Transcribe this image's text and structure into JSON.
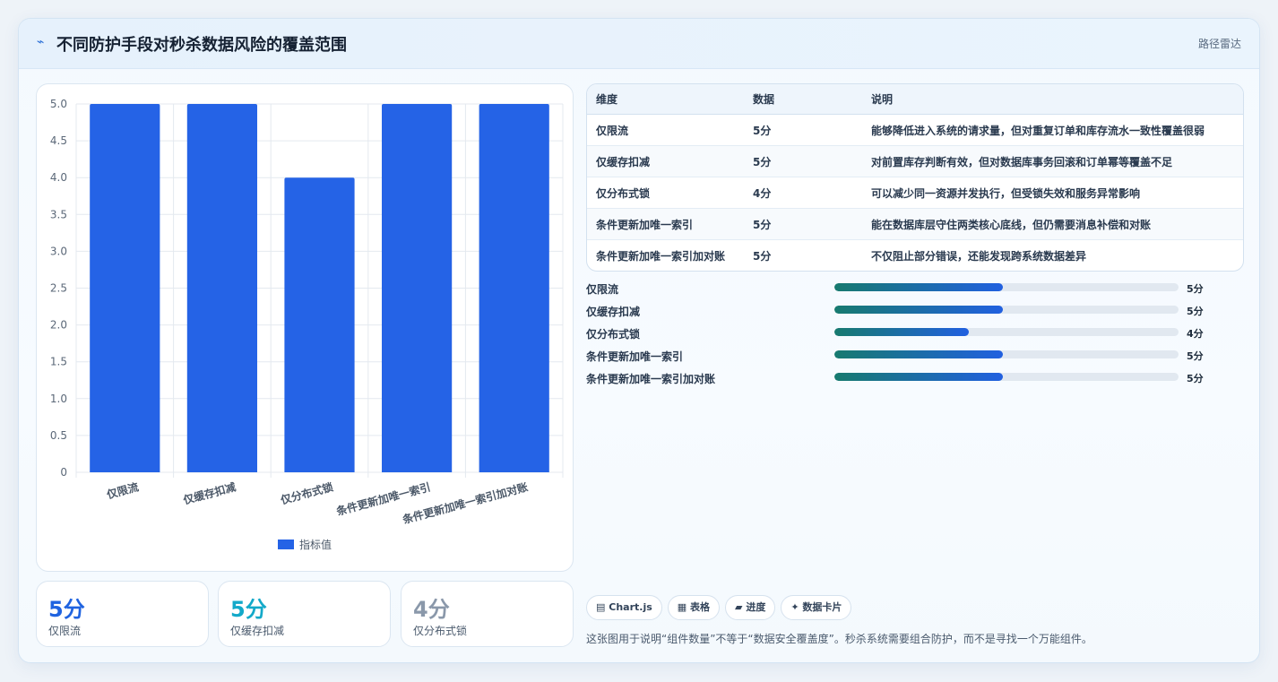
{
  "header": {
    "icon": "pulse-icon",
    "title": "不同防护手段对秒杀数据风险的覆盖范围",
    "tag": "路径雷达"
  },
  "chart_data": {
    "type": "bar",
    "categories": [
      "仅限流",
      "仅缓存扣减",
      "仅分布式锁",
      "条件更新加唯一索引",
      "条件更新加唯一索引加对账"
    ],
    "series": [
      {
        "name": "指标值",
        "values": [
          5,
          5,
          4,
          5,
          5
        ],
        "color": "#2563e6"
      }
    ],
    "yticks": [
      "5.0",
      "4.5",
      "4.0",
      "3.5",
      "3.0",
      "2.5",
      "2.0",
      "1.5",
      "1.0",
      "0.5",
      "0"
    ],
    "ylim": [
      0,
      5
    ],
    "grid": true,
    "legend": "bottom"
  },
  "kpis": [
    {
      "value": "5分",
      "label": "仅限流",
      "color": "#1f63e0"
    },
    {
      "value": "5分",
      "label": "仅缓存扣减",
      "color": "#13a9c9"
    },
    {
      "value": "4分",
      "label": "仅分布式锁",
      "color": "#8a98aa"
    }
  ],
  "table": {
    "headers": [
      "维度",
      "数据",
      "说明"
    ],
    "rows": [
      [
        "仅限流",
        "5分",
        "能够降低进入系统的请求量，但对重复订单和库存流水一致性覆盖很弱"
      ],
      [
        "仅缓存扣减",
        "5分",
        "对前置库存判断有效，但对数据库事务回滚和订单幂等覆盖不足"
      ],
      [
        "仅分布式锁",
        "4分",
        "可以减少同一资源并发执行，但受锁失效和服务异常影响"
      ],
      [
        "条件更新加唯一索引",
        "5分",
        "能在数据库层守住两类核心底线，但仍需要消息补偿和对账"
      ],
      [
        "条件更新加唯一索引加对账",
        "5分",
        "不仅阻止部分错误，还能发现跨系统数据差异"
      ]
    ]
  },
  "progress": [
    {
      "label": "仅限流",
      "value_text": "5分",
      "fraction": 0.49
    },
    {
      "label": "仅缓存扣减",
      "value_text": "5分",
      "fraction": 0.49
    },
    {
      "label": "仅分布式锁",
      "value_text": "4分",
      "fraction": 0.39
    },
    {
      "label": "条件更新加唯一索引",
      "value_text": "5分",
      "fraction": 0.49
    },
    {
      "label": "条件更新加唯一索引加对账",
      "value_text": "5分",
      "fraction": 0.49
    }
  ],
  "chips": [
    {
      "icon": "chart-icon",
      "glyph": "▤",
      "label": "Chart.js"
    },
    {
      "icon": "table-icon",
      "glyph": "▦",
      "label": "表格"
    },
    {
      "icon": "progress-icon",
      "glyph": "▰",
      "label": "进度"
    },
    {
      "icon": "sparkle-icon",
      "glyph": "✦",
      "label": "数据卡片"
    }
  ],
  "note": "这张图用于说明“组件数量”不等于“数据安全覆盖度”。秒杀系统需要组合防护，而不是寻找一个万能组件。"
}
